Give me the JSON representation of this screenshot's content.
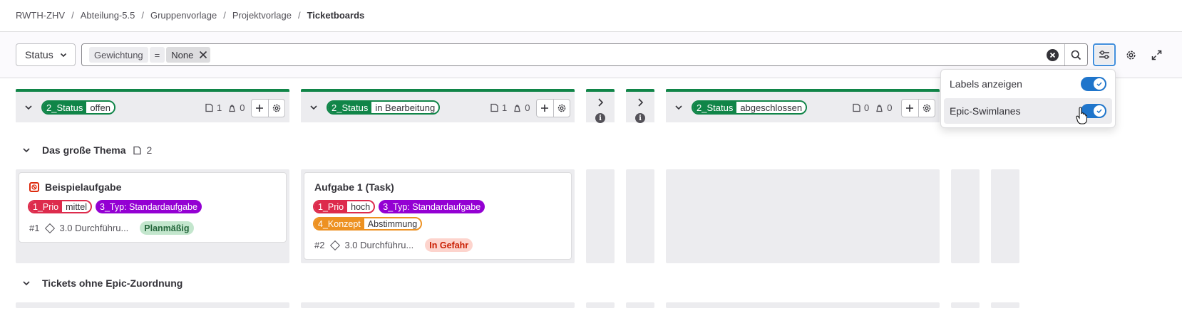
{
  "breadcrumb": [
    "RWTH-ZHV",
    "Abteilung-5.5",
    "Gruppenvorlage",
    "Projektvorlage",
    "Ticketboards"
  ],
  "filter": {
    "status_label": "Status",
    "token_key": "Gewichtung",
    "token_op": "=",
    "token_value": "None"
  },
  "lists": [
    {
      "scope": "2_Status",
      "name": "offen",
      "issues": "1",
      "weight": "0"
    },
    {
      "scope": "2_Status",
      "name": "in Bearbeitung",
      "issues": "1",
      "weight": "0"
    },
    {
      "scope": "2_Status",
      "name": "abgeschlossen",
      "issues": "0",
      "weight": "0"
    }
  ],
  "lanes": {
    "epic_title": "Das große Thema",
    "epic_count": "2",
    "no_epic_title": "Tickets ohne Epic-Zuordnung"
  },
  "cards": [
    {
      "title": "Beispielaufgabe",
      "labels": [
        {
          "k": "1_Prio",
          "v": "mittel",
          "color": "#dd2b4c"
        },
        {
          "k": "3_Typ: Standardaufgabe",
          "v": "",
          "color": "#9400d3"
        }
      ],
      "ref": "#1",
      "milestone": "3.0 Durchführu...",
      "status": "Planmäßig"
    },
    {
      "title": "Aufgabe 1 (Task)",
      "labels": [
        {
          "k": "1_Prio",
          "v": "hoch",
          "color": "#dd2b4c"
        },
        {
          "k": "3_Typ: Standardaufgabe",
          "v": "",
          "color": "#9400d3"
        },
        {
          "k": "4_Konzept",
          "v": "Abstimmung",
          "color": "#ed9121"
        }
      ],
      "ref": "#2",
      "milestone": "3.0 Durchführu...",
      "status": "In Gefahr"
    }
  ],
  "popover": {
    "labels_toggle": "Labels anzeigen",
    "swimlanes_toggle": "Epic-Swimlanes"
  },
  "colors": {
    "status_green": "#108548",
    "toggle_blue": "#1f75cb",
    "ontrack_bg": "#c3e6cd",
    "ontrack_fg": "#24663b",
    "atrisk_bg": "#fdd4cd",
    "atrisk_fg": "#c91c00"
  }
}
